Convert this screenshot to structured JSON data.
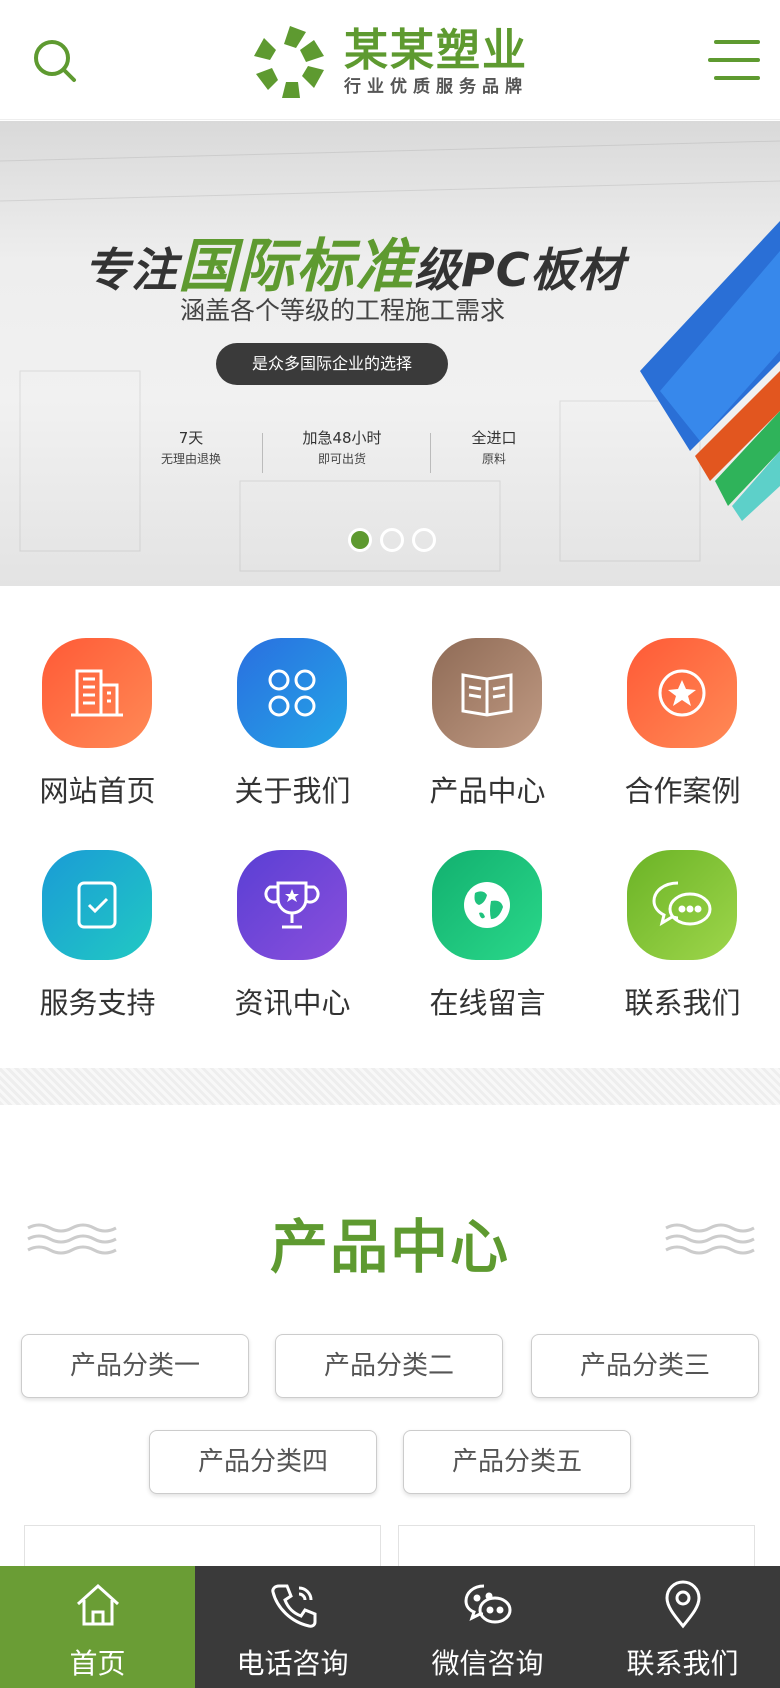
{
  "header": {
    "logo_name": "某某塑业",
    "logo_slogan": "行业优质服务品牌"
  },
  "banner": {
    "title_prefix": "专注",
    "title_highlight": "国际标准",
    "title_suffix": "级PC板材",
    "subtitle": "涵盖各个等级的工程施工需求",
    "pill": "是众多国际企业的选择",
    "features": [
      {
        "line1": "7天",
        "line2": "无理由退换"
      },
      {
        "line1": "加急48小时",
        "line2": "即可出货"
      },
      {
        "line1": "全进口",
        "line2": "原料"
      }
    ],
    "slides_total": 3,
    "slide_active": 1
  },
  "nav": [
    {
      "label": "网站首页",
      "icon": "building-icon",
      "color": "#ff6b3d"
    },
    {
      "label": "关于我们",
      "icon": "grid-icon",
      "color": "#2e8be0"
    },
    {
      "label": "产品中心",
      "icon": "book-icon",
      "color": "#a57f67"
    },
    {
      "label": "合作案例",
      "icon": "star-icon",
      "color": "#ff6b3d"
    },
    {
      "label": "服务支持",
      "icon": "checklist-icon",
      "color": "#18a8c7"
    },
    {
      "label": "资讯中心",
      "icon": "trophy-icon",
      "color": "#6a47d8"
    },
    {
      "label": "在线留言",
      "icon": "globe-icon",
      "color": "#20c07a"
    },
    {
      "label": "联系我们",
      "icon": "chat-icon",
      "color": "#7bbf2e"
    }
  ],
  "products": {
    "title": "产品中心",
    "categories": [
      "产品分类一",
      "产品分类二",
      "产品分类三",
      "产品分类四",
      "产品分类五"
    ]
  },
  "bottom_bar": [
    {
      "label": "首页",
      "icon": "home-icon",
      "active": true
    },
    {
      "label": "电话咨询",
      "icon": "phone-icon",
      "active": false
    },
    {
      "label": "微信咨询",
      "icon": "wechat-icon",
      "active": false
    },
    {
      "label": "联系我们",
      "icon": "location-icon",
      "active": false
    }
  ],
  "colors": {
    "brand": "#5e9a30",
    "bar": "#3a3a3a"
  }
}
